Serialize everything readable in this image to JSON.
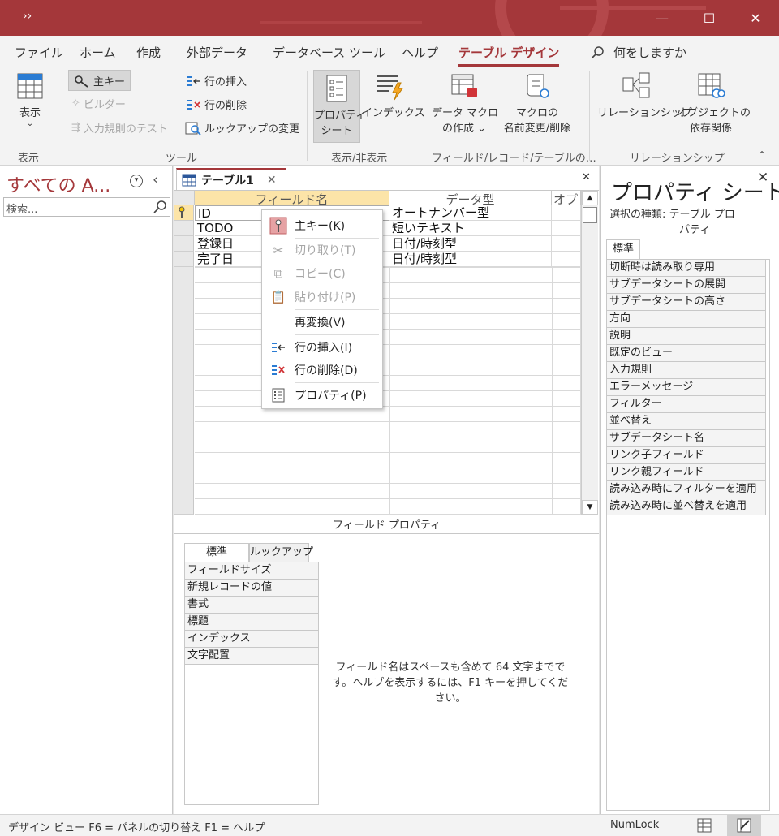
{
  "titlebar": {
    "qat": "››",
    "minimize": "—",
    "maximize": "☐",
    "close": "✕"
  },
  "tabs": [
    {
      "label": "ファイル"
    },
    {
      "label": "ホーム"
    },
    {
      "label": "作成"
    },
    {
      "label": "外部データ"
    },
    {
      "label": "データベース ツール"
    },
    {
      "label": "ヘルプ"
    },
    {
      "label": "テーブル デザイン"
    }
  ],
  "tellme": "何をしますか",
  "ribbon": {
    "view_label": "表示",
    "primary_key": "主キー",
    "builder": "ビルダー",
    "test_rules": "入力規則のテスト",
    "insert_rows": "行の挿入",
    "delete_rows": "行の削除",
    "modify_lookups": "ルックアップの変更",
    "property_sheet": "プロパティ\nシート",
    "property_sheet_l1": "プロパティ",
    "property_sheet_l2": "シート",
    "indexes": "インデックス",
    "data_macro_l1": "データ マクロ",
    "data_macro_l2": "の作成 ⌄",
    "rename_macro_l1": "マクロの",
    "rename_macro_l2": "名前変更/削除",
    "relationships": "リレーションシップ",
    "obj_dep_l1": "オブジェクトの",
    "obj_dep_l2": "依存関係",
    "groups": {
      "view": "表示",
      "tools": "ツール",
      "showhide": "表示/非表示",
      "field_events": "フィールド/レコード/テーブルの…",
      "relationships": "リレーションシップ"
    }
  },
  "nav": {
    "title": "すべての A...",
    "search_placeholder": "検索..."
  },
  "document": {
    "tab_label": "テーブル1",
    "columns": [
      "フィールド名",
      "データ型",
      "オプ"
    ],
    "rows": [
      {
        "field": "ID",
        "type": "オートナンバー型",
        "pk": true
      },
      {
        "field": "TODO",
        "type": "短いテキスト"
      },
      {
        "field": "登録日",
        "type": "日付/時刻型"
      },
      {
        "field": "完了日",
        "type": "日付/時刻型"
      }
    ]
  },
  "context_menu": [
    {
      "label": "主キー(K)",
      "icon": "key-icon",
      "disabled": false
    },
    {
      "label": "切り取り(T)",
      "icon": "scissors-icon",
      "disabled": true
    },
    {
      "label": "コピー(C)",
      "icon": "copy-icon",
      "disabled": true
    },
    {
      "label": "貼り付け(P)",
      "icon": "paste-icon",
      "disabled": true
    },
    {
      "label": "再変換(V)",
      "icon": "",
      "disabled": false
    },
    {
      "label": "行の挿入(I)",
      "icon": "insert-rows-icon",
      "disabled": false
    },
    {
      "label": "行の削除(D)",
      "icon": "delete-rows-icon",
      "disabled": false
    },
    {
      "label": "プロパティ(P)",
      "icon": "properties-icon",
      "disabled": false
    }
  ],
  "field_properties": {
    "title": "フィールド プロパティ",
    "tabs": [
      "標準",
      "ルックアップ"
    ],
    "items": [
      "フィールドサイズ",
      "新規レコードの値",
      "書式",
      "標題",
      "インデックス",
      "文字配置"
    ],
    "help": "フィールド名はスペースも含めて 64 文字までです。ヘルプを表示するには、F1 キーを押してください。"
  },
  "property_sheet": {
    "title": "プロパティ シート",
    "selection_label": "選択の種類:  テーブル プロ",
    "selection_label2": "パティ",
    "tab": "標準",
    "items": [
      "切断時は読み取り専用",
      "サブデータシートの展開",
      "サブデータシートの高さ",
      "方向",
      "説明",
      "既定のビュー",
      "入力規則",
      "エラーメッセージ",
      "フィルター",
      "並べ替え",
      "サブデータシート名",
      "リンク子フィールド",
      "リンク親フィールド",
      "読み込み時にフィルターを適用",
      "読み込み時に並べ替えを適用"
    ]
  },
  "statusbar": {
    "left": "デザイン ビュー    F6 = パネルの切り替え    F1 = ヘルプ",
    "numlock": "NumLock"
  },
  "colors": {
    "accent": "#a4373a",
    "ribbon": "#f3f3f3"
  }
}
